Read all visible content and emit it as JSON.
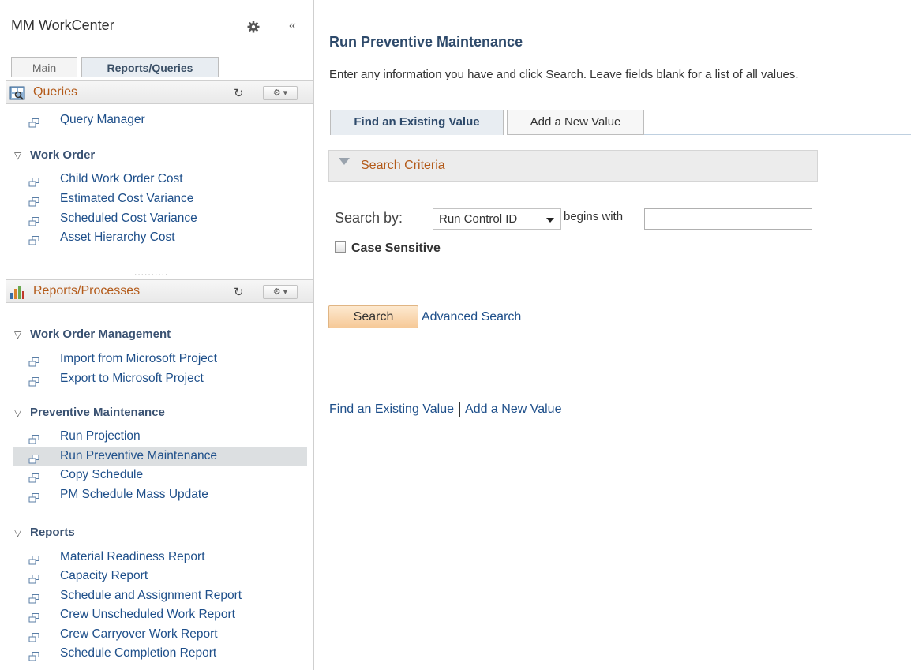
{
  "workcenter": {
    "title": "MM WorkCenter",
    "collapse_glyph": "«",
    "tabs": [
      {
        "label": "Main"
      },
      {
        "label": "Reports/Queries"
      }
    ],
    "queries": {
      "title": "Queries",
      "icon": "queries-icon",
      "items": [
        {
          "label": "Query Manager"
        }
      ],
      "sections": [
        {
          "title": "Work Order",
          "items": [
            {
              "label": "Child Work Order Cost"
            },
            {
              "label": "Estimated Cost Variance"
            },
            {
              "label": "Scheduled Cost Variance"
            },
            {
              "label": "Asset Hierarchy Cost"
            }
          ]
        }
      ]
    },
    "splitter": "..........",
    "reports": {
      "title": "Reports/Processes",
      "icon": "bar-chart-icon",
      "sections": [
        {
          "title": "Work Order Management",
          "items": [
            {
              "label": "Import from Microsoft Project"
            },
            {
              "label": "Export to Microsoft Project"
            }
          ]
        },
        {
          "title": "Preventive Maintenance",
          "items": [
            {
              "label": "Run Projection"
            },
            {
              "label": "Run Preventive Maintenance",
              "selected": true
            },
            {
              "label": "Copy Schedule"
            },
            {
              "label": "PM Schedule Mass Update"
            }
          ]
        },
        {
          "title": "Reports",
          "items": [
            {
              "label": "Material Readiness Report"
            },
            {
              "label": "Capacity Report"
            },
            {
              "label": "Schedule and Assignment Report"
            },
            {
              "label": "Crew Unscheduled Work Report"
            },
            {
              "label": "Crew Carryover Work Report"
            },
            {
              "label": "Schedule Completion Report"
            }
          ]
        }
      ]
    }
  },
  "main": {
    "title": "Run Preventive Maintenance",
    "instructions": "Enter any information you have and click Search. Leave fields blank for a list of all values.",
    "tabs": [
      {
        "label": "Find an Existing Value"
      },
      {
        "label": "Add a New Value"
      }
    ],
    "criteria_label": "Search Criteria",
    "search_by_label": "Search by:",
    "search_by_value": "Run Control ID",
    "operator": "begins with",
    "input_value": "",
    "case_sensitive_label": "Case Sensitive",
    "case_sensitive_checked": false,
    "search_button": "Search",
    "advanced_search": "Advanced Search",
    "bottom_links": [
      "Find an Existing Value",
      "Add a New Value"
    ]
  },
  "colors": {
    "link": "#1e4f8a",
    "pagelet_title": "#b35a19",
    "heading": "#2e4a6b",
    "selected_row": "#dcdfe1",
    "search_button": "#f6c998"
  }
}
